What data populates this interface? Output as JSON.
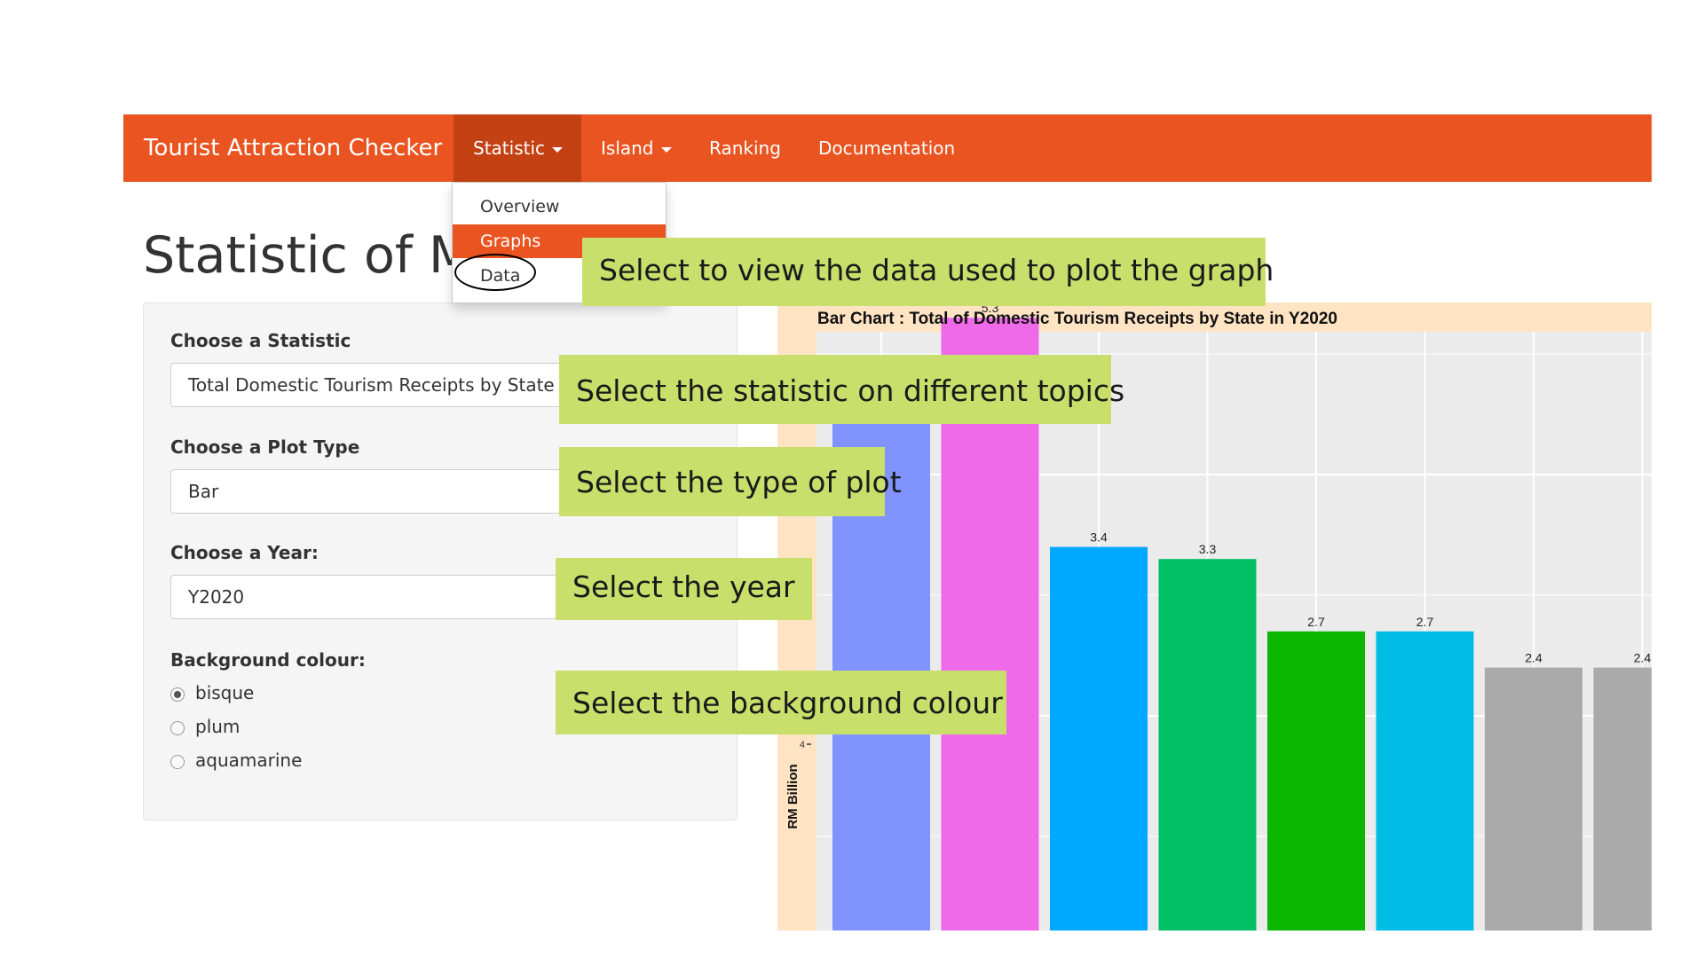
{
  "navbar": {
    "brand": "Tourist Attraction Checker",
    "items": [
      {
        "label": "Statistic"
      },
      {
        "label": "Island"
      },
      {
        "label": "Ranking"
      },
      {
        "label": "Documentation"
      }
    ]
  },
  "dropdown": {
    "items": [
      {
        "label": "Overview"
      },
      {
        "label": "Graphs"
      },
      {
        "label": "Data"
      }
    ]
  },
  "page_title": "Statistic of Ma",
  "sidebar": {
    "statistic_label": "Choose a Statistic",
    "statistic_value": "Total Domestic Tourism Receipts by State",
    "plot_type_label": "Choose a Plot Type",
    "plot_type_value": "Bar",
    "year_label": "Choose a Year:",
    "year_value": "Y2020",
    "bg_label": "Background colour:",
    "bg_options": [
      {
        "label": "bisque",
        "checked": true
      },
      {
        "label": "plum",
        "checked": false
      },
      {
        "label": "aquamarine",
        "checked": false
      }
    ]
  },
  "annotations": {
    "data": "Select to view the data used to plot the graph",
    "statistic": "Select the statistic on different topics",
    "plot_type": "Select the type of plot",
    "year": "Select the  year",
    "background": "Select the  background colour"
  },
  "colors": {
    "navbar": "#e95420",
    "callout": "#c9df6b",
    "chart_background": "#ffe4c4",
    "panel": "#ebebeb"
  },
  "chart_data": {
    "type": "bar",
    "title": "Bar Chart : Total of Domestic Tourism Receipts by State in Y2020",
    "ylabel": "RM Billion",
    "y_tick_labels": [
      "4"
    ],
    "ylim": [
      0,
      8.6
    ],
    "grid": true,
    "bars": [
      {
        "value": null,
        "label": "",
        "color": "#8093ff"
      },
      {
        "value": 5.3,
        "label": "5.3",
        "color": "#ee6ae8"
      },
      {
        "value": 3.4,
        "label": "3.4",
        "color": "#00a9ff"
      },
      {
        "value": 3.3,
        "label": "3.3",
        "color": "#00bf64"
      },
      {
        "value": 2.7,
        "label": "2.7",
        "color": "#0cb702"
      },
      {
        "value": 2.7,
        "label": "2.7",
        "color": "#00bde6"
      },
      {
        "value": 2.4,
        "label": "2.4",
        "color": "#aaaaaa"
      },
      {
        "value": 2.4,
        "label": "2.4",
        "color": "#aaaaaa"
      }
    ]
  }
}
